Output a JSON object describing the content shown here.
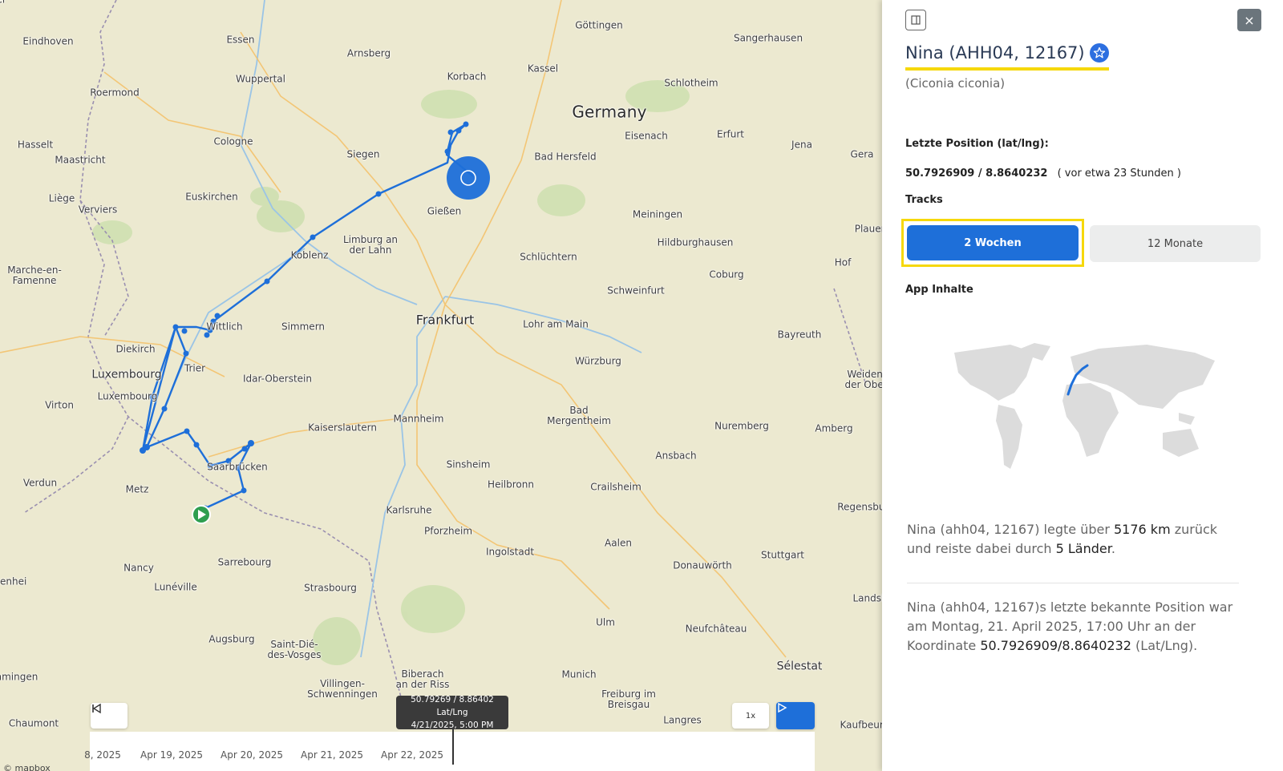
{
  "map": {
    "places": [
      {
        "name": "Eindhoven"
      },
      {
        "name": "Essen"
      },
      {
        "name": "Arnsberg"
      },
      {
        "name": "Göttingen"
      },
      {
        "name": "Sangerhausen"
      },
      {
        "name": "Roermond"
      },
      {
        "name": "Wuppertal"
      },
      {
        "name": "Korbach"
      },
      {
        "name": "Kassel"
      },
      {
        "name": "Germany"
      },
      {
        "name": "Schlotheim"
      },
      {
        "name": "Hasselt"
      },
      {
        "name": "Maastricht"
      },
      {
        "name": "Cologne"
      },
      {
        "name": "Siegen"
      },
      {
        "name": "Eisenach"
      },
      {
        "name": "Erfurt"
      },
      {
        "name": "Jena"
      },
      {
        "name": "Gera"
      },
      {
        "name": "Bad Hersfeld"
      },
      {
        "name": "Liège"
      },
      {
        "name": "Euskirchen"
      },
      {
        "name": "Verviers"
      },
      {
        "name": "Gießen"
      },
      {
        "name": "Meiningen"
      },
      {
        "name": "Limburg an\nder Lahn"
      },
      {
        "name": "Koblenz"
      },
      {
        "name": "Hildburghausen"
      },
      {
        "name": "Plauen"
      },
      {
        "name": "Marche-en-\nFamenne"
      },
      {
        "name": "Schlüchtern"
      },
      {
        "name": "Coburg"
      },
      {
        "name": "Hof"
      },
      {
        "name": "Frankfurt"
      },
      {
        "name": "Schweinfurt"
      },
      {
        "name": "Lohr am Main"
      },
      {
        "name": "Wittlich"
      },
      {
        "name": "Simmern"
      },
      {
        "name": "Bayreuth"
      },
      {
        "name": "Diekirch"
      },
      {
        "name": "Würzburg"
      },
      {
        "name": "Luxembourg"
      },
      {
        "name": "Trier"
      },
      {
        "name": "Idar-Oberstein"
      },
      {
        "name": "Weiden in\nder Oberpf"
      },
      {
        "name": "Luxembourg"
      },
      {
        "name": "Virton"
      },
      {
        "name": "Bad\nMergentheim"
      },
      {
        "name": "Kaiserslautern"
      },
      {
        "name": "Mannheim"
      },
      {
        "name": "Nuremberg"
      },
      {
        "name": "Amberg"
      },
      {
        "name": "Ansbach"
      },
      {
        "name": "Sinsheim"
      },
      {
        "name": "Saarbrücken"
      },
      {
        "name": "Verdun"
      },
      {
        "name": "Heilbronn"
      },
      {
        "name": "Crailsheim"
      },
      {
        "name": "Metz"
      },
      {
        "name": "Regensburg"
      },
      {
        "name": "Karlsruhe"
      },
      {
        "name": "Pforzheim"
      },
      {
        "name": "Aalen"
      },
      {
        "name": "Ingolstadt"
      },
      {
        "name": "Stuttgart"
      },
      {
        "name": "Nancy"
      },
      {
        "name": "Sarrebourg"
      },
      {
        "name": "Donauwörth"
      },
      {
        "name": "Strasbourg"
      },
      {
        "name": "Lunéville"
      },
      {
        "name": "Landsh"
      },
      {
        "name": "Ulm"
      },
      {
        "name": "Neufchâteau"
      },
      {
        "name": "Augsburg"
      },
      {
        "name": "Saint-Dié-\ndes-Vosges"
      },
      {
        "name": "Sélestat"
      },
      {
        "name": "Munich"
      },
      {
        "name": "Biberach\nan der Riss"
      },
      {
        "name": "Villingen-\nSchwenningen"
      },
      {
        "name": "Freiburg im\nBreisgau"
      },
      {
        "name": "Memmingen"
      },
      {
        "name": "Chaumont"
      },
      {
        "name": "Langres"
      },
      {
        "name": "Kaufbeuren"
      },
      {
        "name": "Rosenhei"
      },
      {
        "name": "ier"
      }
    ],
    "track_color": "#1e6fd9",
    "start_marker_color": "#2e9e4f",
    "attribution": "© mapbox"
  },
  "player": {
    "tooltip_coords": "50.79269 / 8.86402 Lat/Lng",
    "tooltip_time": "4/21/2025, 5:00 PM",
    "speed_label": "1x",
    "timeline_ticks": [
      "8, 2025",
      "Apr 19, 2025",
      "Apr 20, 2025",
      "Apr 21, 2025",
      "Apr 22, 2025"
    ]
  },
  "panel": {
    "title": "Nina (AHH04, 12167)",
    "species": "(Ciconia ciconia)",
    "last_position_label": "Letzte Position (lat/lng):",
    "last_position_value": "50.7926909 / 8.8640232",
    "last_position_ago": "( vor etwa 23 Stunden )",
    "tracks_label": "Tracks",
    "tab_2w": "2 Wochen",
    "tab_12m": "12 Monate",
    "app_content_label": "App Inhalte",
    "summary": {
      "name": "Nina (ahh04, 12167)",
      "t1": " legte über ",
      "distance": "5176 km",
      "t2": " zurück und reiste dabei durch ",
      "countries": "5 Länder",
      "t3": "."
    },
    "last_known": {
      "t1": "Nina (ahh04, 12167)s letzte bekannte Position war am Montag, 21. April 2025, 17:00 Uhr an der Koordinate ",
      "coords": "50.7926909/8.8640232",
      "t2": " (Lat/Lng)."
    },
    "accent_color": "#1e6fd9",
    "highlight_color": "#f6d80b"
  }
}
